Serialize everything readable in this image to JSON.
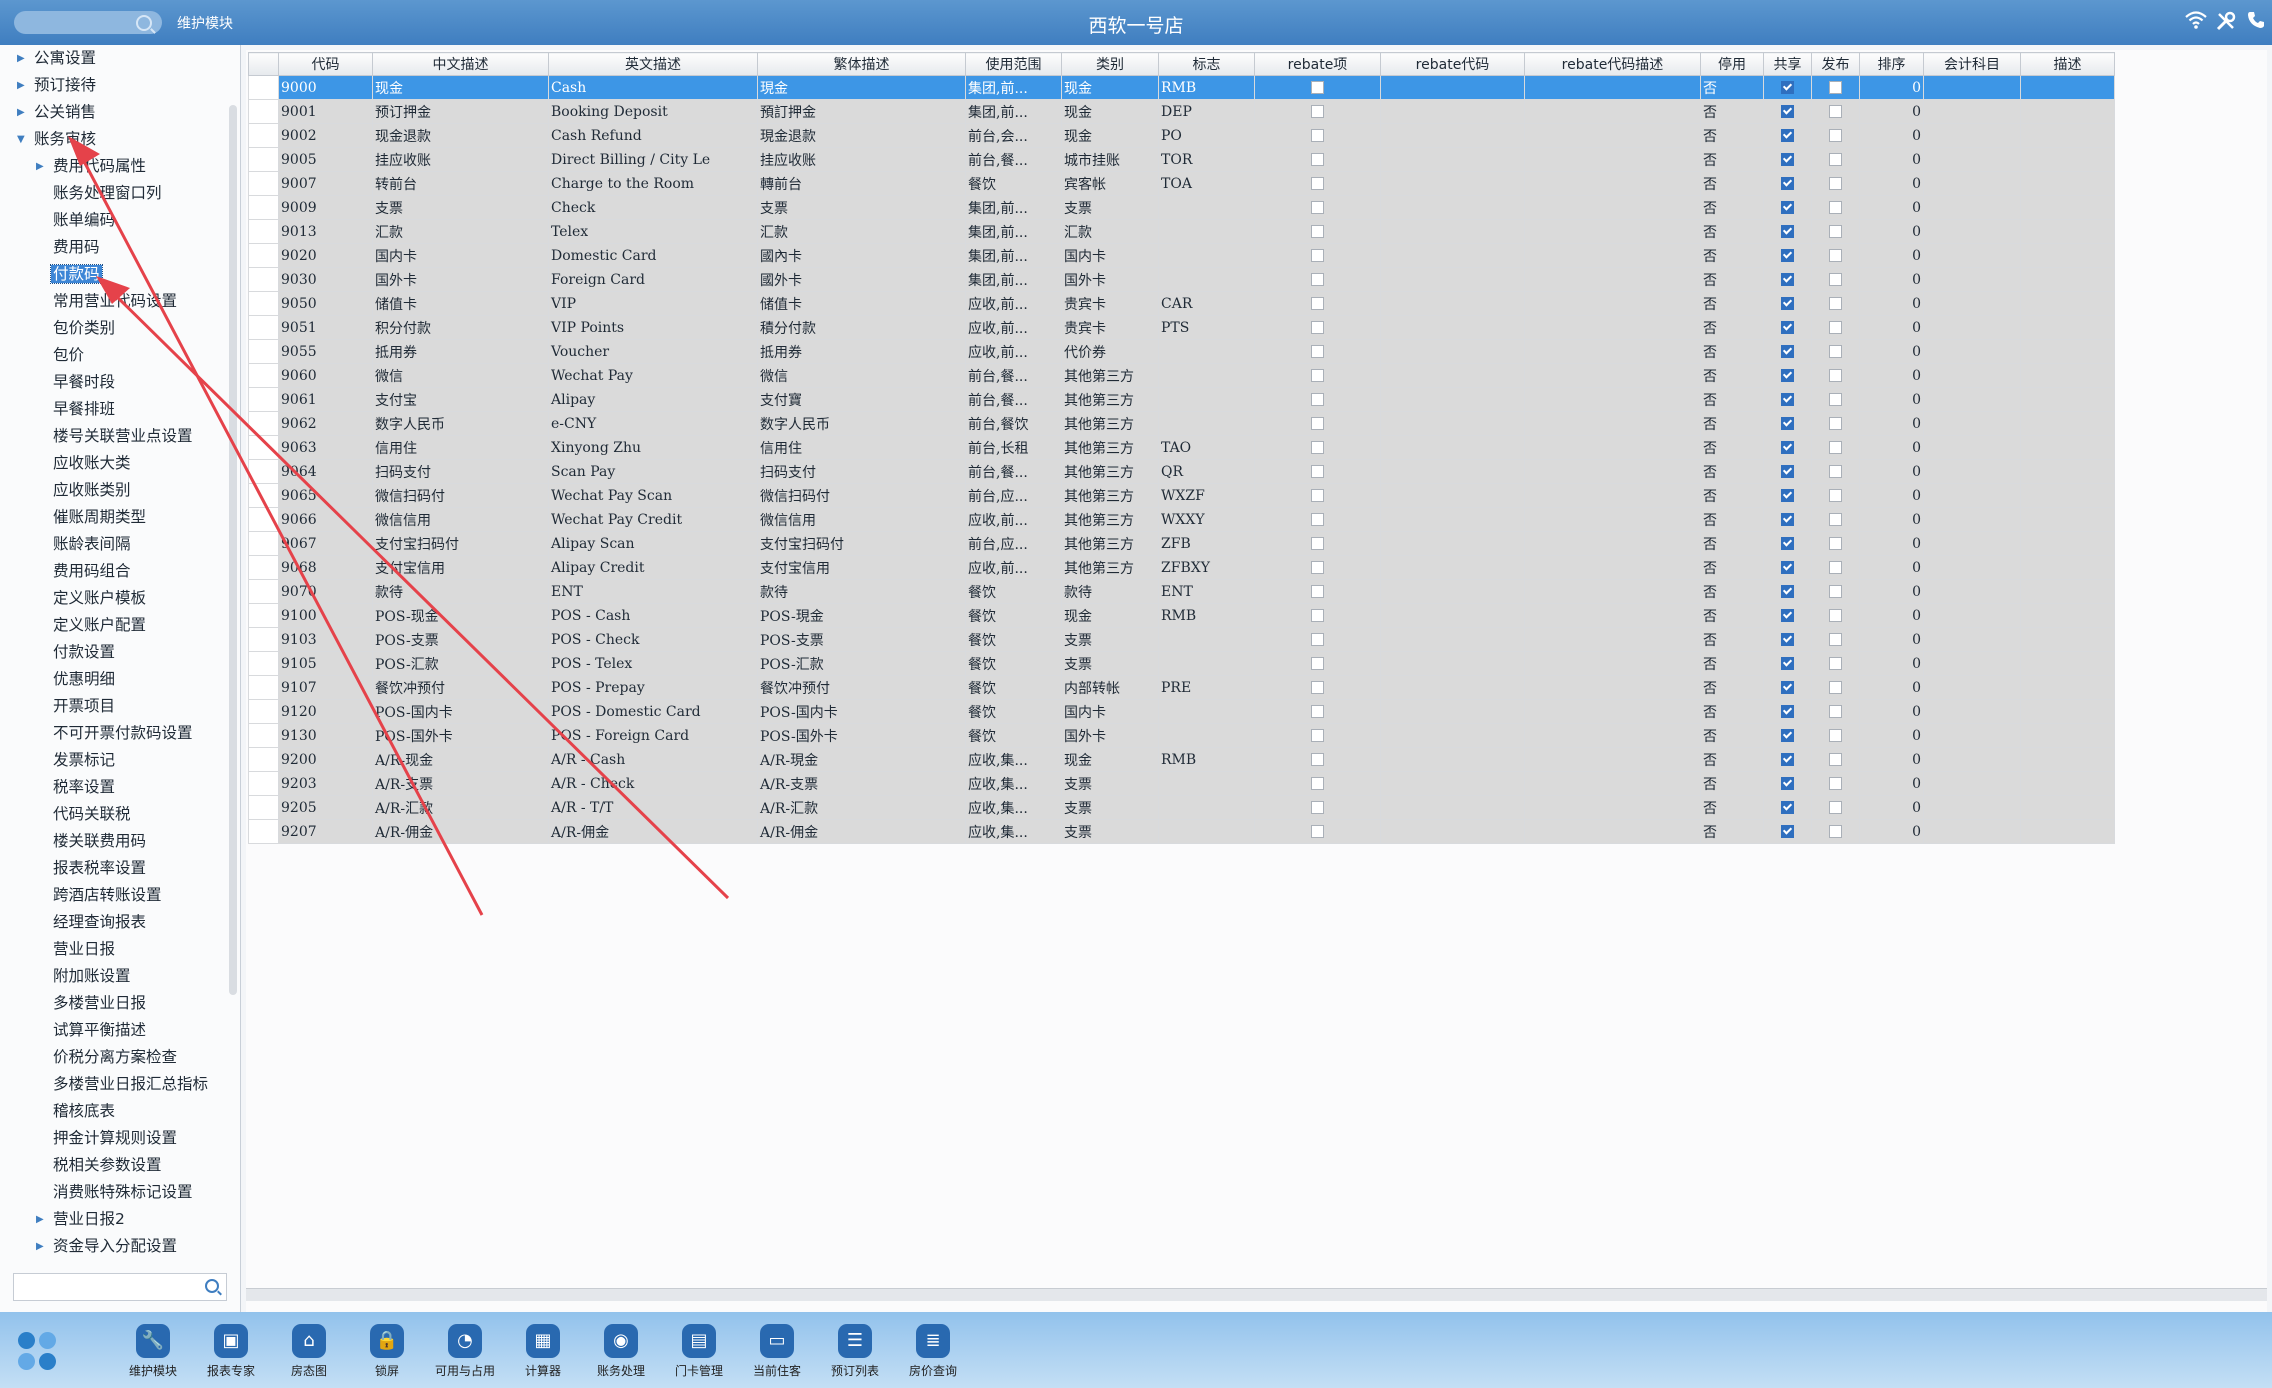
{
  "topbar": {
    "module": "维护模块",
    "title": "西软一号店",
    "icons": [
      "wifi-icon",
      "tools-icon",
      "phone-icon"
    ]
  },
  "sidebar": {
    "items": [
      {
        "label": "公寓设置",
        "level": 1,
        "expandable": true,
        "expanded": false
      },
      {
        "label": "预订接待",
        "level": 1,
        "expandable": true,
        "expanded": false
      },
      {
        "label": "公关销售",
        "level": 1,
        "expandable": true,
        "expanded": false
      },
      {
        "label": "账务审核",
        "level": 1,
        "expandable": true,
        "expanded": true
      },
      {
        "label": "费用代码属性",
        "level": 2,
        "expandable": true,
        "expanded": false
      },
      {
        "label": "账务处理窗口列",
        "level": 2
      },
      {
        "label": "账单编码",
        "level": 2
      },
      {
        "label": "费用码",
        "level": 2
      },
      {
        "label": "付款码",
        "level": 2,
        "selected": true
      },
      {
        "label": "常用营业代码设置",
        "level": 2
      },
      {
        "label": "包价类别",
        "level": 2
      },
      {
        "label": "包价",
        "level": 2
      },
      {
        "label": "早餐时段",
        "level": 2
      },
      {
        "label": "早餐排班",
        "level": 2
      },
      {
        "label": "楼号关联营业点设置",
        "level": 2
      },
      {
        "label": "应收账大类",
        "level": 2
      },
      {
        "label": "应收账类别",
        "level": 2
      },
      {
        "label": "催账周期类型",
        "level": 2
      },
      {
        "label": "账龄表间隔",
        "level": 2
      },
      {
        "label": "费用码组合",
        "level": 2
      },
      {
        "label": "定义账户模板",
        "level": 2
      },
      {
        "label": "定义账户配置",
        "level": 2
      },
      {
        "label": "付款设置",
        "level": 2
      },
      {
        "label": "优惠明细",
        "level": 2
      },
      {
        "label": "开票项目",
        "level": 2
      },
      {
        "label": "不可开票付款码设置",
        "level": 2
      },
      {
        "label": "发票标记",
        "level": 2
      },
      {
        "label": "税率设置",
        "level": 2
      },
      {
        "label": "代码关联税",
        "level": 2
      },
      {
        "label": "楼关联费用码",
        "level": 2
      },
      {
        "label": "报表税率设置",
        "level": 2
      },
      {
        "label": "跨酒店转账设置",
        "level": 2
      },
      {
        "label": "经理查询报表",
        "level": 2
      },
      {
        "label": "营业日报",
        "level": 2
      },
      {
        "label": "附加账设置",
        "level": 2
      },
      {
        "label": "多楼营业日报",
        "level": 2
      },
      {
        "label": "试算平衡描述",
        "level": 2
      },
      {
        "label": "价税分离方案检查",
        "level": 2
      },
      {
        "label": "多楼营业日报汇总指标",
        "level": 2
      },
      {
        "label": "稽核底表",
        "level": 2
      },
      {
        "label": "押金计算规则设置",
        "level": 2
      },
      {
        "label": "税相关参数设置",
        "level": 2
      },
      {
        "label": "消费账特殊标记设置",
        "level": 2
      },
      {
        "label": "营业日报2",
        "level": 2,
        "expandable": true,
        "expanded": false
      },
      {
        "label": "资金导入分配设置",
        "level": 2,
        "expandable": true,
        "expanded": false
      }
    ],
    "search_placeholder": ""
  },
  "grid": {
    "columns": [
      "代码",
      "中文描述",
      "英文描述",
      "繁体描述",
      "使用范围",
      "类别",
      "标志",
      "rebate项",
      "rebate代码",
      "rebate代码描述",
      "停用",
      "共享",
      "发布",
      "排序",
      "会计科目",
      "描述"
    ],
    "rows": [
      [
        "9000",
        "现金",
        "Cash",
        "現金",
        "集团,前...",
        "现金",
        "RMB",
        false,
        "",
        "",
        "否",
        true,
        false,
        "0",
        "",
        ""
      ],
      [
        "9001",
        "预订押金",
        "Booking Deposit",
        "預訂押金",
        "集团,前...",
        "现金",
        "DEP",
        false,
        "",
        "",
        "否",
        true,
        false,
        "0",
        "",
        ""
      ],
      [
        "9002",
        "现金退款",
        "Cash Refund",
        "現金退款",
        "前台,会...",
        "现金",
        "PO",
        false,
        "",
        "",
        "否",
        true,
        false,
        "0",
        "",
        ""
      ],
      [
        "9005",
        "挂应收账",
        "Direct Billing / City Le",
        "挂应收账",
        "前台,餐...",
        "城市挂账",
        "TOR",
        false,
        "",
        "",
        "否",
        true,
        false,
        "0",
        "",
        ""
      ],
      [
        "9007",
        "转前台",
        "Charge to the Room",
        "轉前台",
        "餐饮",
        "宾客帐",
        "TOA",
        false,
        "",
        "",
        "否",
        true,
        false,
        "0",
        "",
        ""
      ],
      [
        "9009",
        "支票",
        "Check",
        "支票",
        "集团,前...",
        "支票",
        "",
        false,
        "",
        "",
        "否",
        true,
        false,
        "0",
        "",
        ""
      ],
      [
        "9013",
        "汇款",
        "Telex",
        "汇款",
        "集团,前...",
        "汇款",
        "",
        false,
        "",
        "",
        "否",
        true,
        false,
        "0",
        "",
        ""
      ],
      [
        "9020",
        "国内卡",
        "Domestic Card",
        "國內卡",
        "集团,前...",
        "国内卡",
        "",
        false,
        "",
        "",
        "否",
        true,
        false,
        "0",
        "",
        ""
      ],
      [
        "9030",
        "国外卡",
        "Foreign Card",
        "國外卡",
        "集团,前...",
        "国外卡",
        "",
        false,
        "",
        "",
        "否",
        true,
        false,
        "0",
        "",
        ""
      ],
      [
        "9050",
        "储值卡",
        "VIP",
        "储值卡",
        "应收,前...",
        "贵宾卡",
        "CAR",
        false,
        "",
        "",
        "否",
        true,
        false,
        "0",
        "",
        ""
      ],
      [
        "9051",
        "积分付款",
        "VIP Points",
        "積分付款",
        "应收,前...",
        "贵宾卡",
        "PTS",
        false,
        "",
        "",
        "否",
        true,
        false,
        "0",
        "",
        ""
      ],
      [
        "9055",
        "抵用券",
        "Voucher",
        "抵用券",
        "应收,前...",
        "代价券",
        "",
        false,
        "",
        "",
        "否",
        true,
        false,
        "0",
        "",
        ""
      ],
      [
        "9060",
        "微信",
        "Wechat Pay",
        "微信",
        "前台,餐...",
        "其他第三方",
        "",
        false,
        "",
        "",
        "否",
        true,
        false,
        "0",
        "",
        ""
      ],
      [
        "9061",
        "支付宝",
        "Alipay",
        "支付寶",
        "前台,餐...",
        "其他第三方",
        "",
        false,
        "",
        "",
        "否",
        true,
        false,
        "0",
        "",
        ""
      ],
      [
        "9062",
        "数字人民币",
        "e-CNY",
        "数字人民币",
        "前台,餐饮",
        "其他第三方",
        "",
        false,
        "",
        "",
        "否",
        true,
        false,
        "0",
        "",
        ""
      ],
      [
        "9063",
        "信用住",
        "Xinyong Zhu",
        "信用住",
        "前台,长租",
        "其他第三方",
        "TAO",
        false,
        "",
        "",
        "否",
        true,
        false,
        "0",
        "",
        ""
      ],
      [
        "9064",
        "扫码支付",
        "Scan Pay",
        "扫码支付",
        "前台,餐...",
        "其他第三方",
        "QR",
        false,
        "",
        "",
        "否",
        true,
        false,
        "0",
        "",
        ""
      ],
      [
        "9065",
        "微信扫码付",
        "Wechat Pay Scan",
        "微信扫码付",
        "前台,应...",
        "其他第三方",
        "WXZF",
        false,
        "",
        "",
        "否",
        true,
        false,
        "0",
        "",
        ""
      ],
      [
        "9066",
        "微信信用",
        "Wechat Pay Credit",
        "微信信用",
        "应收,前...",
        "其他第三方",
        "WXXY",
        false,
        "",
        "",
        "否",
        true,
        false,
        "0",
        "",
        ""
      ],
      [
        "9067",
        "支付宝扫码付",
        "Alipay Scan",
        "支付宝扫码付",
        "前台,应...",
        "其他第三方",
        "ZFB",
        false,
        "",
        "",
        "否",
        true,
        false,
        "0",
        "",
        ""
      ],
      [
        "9068",
        "支付宝信用",
        "Alipay Credit",
        "支付宝信用",
        "应收,前...",
        "其他第三方",
        "ZFBXY",
        false,
        "",
        "",
        "否",
        true,
        false,
        "0",
        "",
        ""
      ],
      [
        "9070",
        "款待",
        "ENT",
        "款待",
        "餐饮",
        "款待",
        "ENT",
        false,
        "",
        "",
        "否",
        true,
        false,
        "0",
        "",
        ""
      ],
      [
        "9100",
        "POS-现金",
        "POS - Cash",
        "POS-現金",
        "餐饮",
        "现金",
        "RMB",
        false,
        "",
        "",
        "否",
        true,
        false,
        "0",
        "",
        ""
      ],
      [
        "9103",
        "POS-支票",
        "POS - Check",
        "POS-支票",
        "餐饮",
        "支票",
        "",
        false,
        "",
        "",
        "否",
        true,
        false,
        "0",
        "",
        ""
      ],
      [
        "9105",
        "POS-汇款",
        "POS - Telex",
        "POS-汇款",
        "餐饮",
        "支票",
        "",
        false,
        "",
        "",
        "否",
        true,
        false,
        "0",
        "",
        ""
      ],
      [
        "9107",
        "餐饮冲预付",
        "POS - Prepay",
        "餐饮冲预付",
        "餐饮",
        "内部转帐",
        "PRE",
        false,
        "",
        "",
        "否",
        true,
        false,
        "0",
        "",
        ""
      ],
      [
        "9120",
        "POS-国内卡",
        "POS - Domestic Card",
        "POS-国内卡",
        "餐饮",
        "国内卡",
        "",
        false,
        "",
        "",
        "否",
        true,
        false,
        "0",
        "",
        ""
      ],
      [
        "9130",
        "POS-国外卡",
        "POS - Foreign Card",
        "POS-国外卡",
        "餐饮",
        "国外卡",
        "",
        false,
        "",
        "",
        "否",
        true,
        false,
        "0",
        "",
        ""
      ],
      [
        "9200",
        "A/R-现金",
        "A/R - Cash",
        "A/R-現金",
        "应收,集...",
        "现金",
        "RMB",
        false,
        "",
        "",
        "否",
        true,
        false,
        "0",
        "",
        ""
      ],
      [
        "9203",
        "A/R-支票",
        "A/R - Check",
        "A/R-支票",
        "应收,集...",
        "支票",
        "",
        false,
        "",
        "",
        "否",
        true,
        false,
        "0",
        "",
        ""
      ],
      [
        "9205",
        "A/R-汇款",
        "A/R - T/T",
        "A/R-汇款",
        "应收,集...",
        "支票",
        "",
        false,
        "",
        "",
        "否",
        true,
        false,
        "0",
        "",
        ""
      ],
      [
        "9207",
        "A/R-佣金",
        "A/R-佣金",
        "A/R-佣金",
        "应收,集...",
        "支票",
        "",
        false,
        "",
        "",
        "否",
        true,
        false,
        "0",
        "",
        ""
      ]
    ],
    "selected_row": 0
  },
  "taskbar": {
    "items": [
      {
        "label": "维护模块",
        "icon": "wrench-icon"
      },
      {
        "label": "报表专家",
        "icon": "cube-icon"
      },
      {
        "label": "房态图",
        "icon": "bank-icon"
      },
      {
        "label": "锁屏",
        "icon": "lock-icon"
      },
      {
        "label": "可用与占用",
        "icon": "pie-chart-icon"
      },
      {
        "label": "计算器",
        "icon": "calculator-icon"
      },
      {
        "label": "账务处理",
        "icon": "coin-icon"
      },
      {
        "label": "门卡管理",
        "icon": "card-icon"
      },
      {
        "label": "当前住客",
        "icon": "id-card-icon"
      },
      {
        "label": "预订列表",
        "icon": "list-icon"
      },
      {
        "label": "房价查询",
        "icon": "database-icon"
      }
    ]
  },
  "colors": {
    "topbar": "#4a8ac8",
    "selection": "#3d96e6",
    "annotation_arrow": "#e5424a"
  }
}
